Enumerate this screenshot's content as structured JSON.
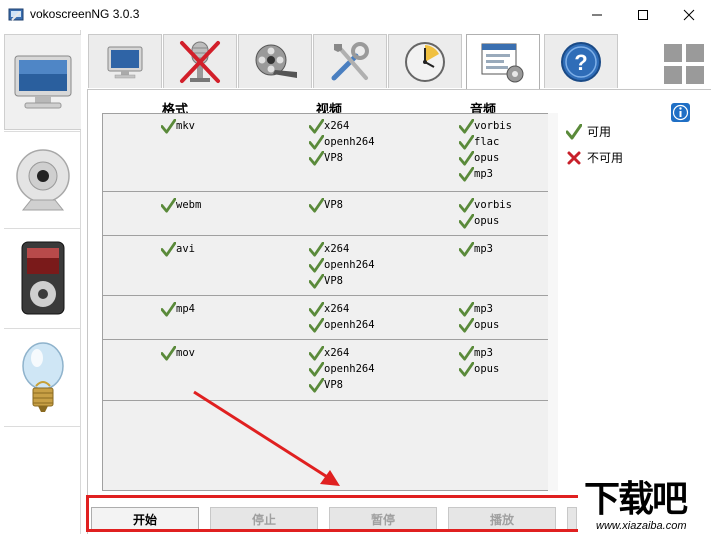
{
  "window": {
    "title": "vokoscreenNG 3.0.3",
    "min_glyph": "—",
    "max_glyph": "☐",
    "close_glyph": "✕"
  },
  "sidebar": {
    "items": [
      {
        "name": "screencast",
        "icon": "monitor-icon",
        "active": true
      },
      {
        "name": "camera",
        "icon": "webcam-icon",
        "active": false
      },
      {
        "name": "player",
        "icon": "media-player-icon",
        "active": false
      },
      {
        "name": "log",
        "icon": "light-bulb-icon",
        "active": false
      }
    ]
  },
  "tabs": [
    {
      "icon": "monitor-icon",
      "active": false
    },
    {
      "icon": "microphone-disabled-icon",
      "active": false
    },
    {
      "icon": "film-reel-icon",
      "active": false
    },
    {
      "icon": "tools-icon",
      "active": false
    },
    {
      "icon": "timer-icon",
      "active": false
    },
    {
      "icon": "window-settings-icon",
      "active": true
    },
    {
      "icon": "help-icon",
      "active": false
    }
  ],
  "table": {
    "headers": {
      "format": "格式",
      "video": "视频",
      "audio": "音频"
    },
    "rows": [
      {
        "format": "mkv",
        "video": [
          "x264",
          "openh264",
          "VP8"
        ],
        "audio": [
          "vorbis",
          "flac",
          "opus",
          "mp3"
        ]
      },
      {
        "format": "webm",
        "video": [
          "VP8"
        ],
        "audio": [
          "vorbis",
          "opus"
        ]
      },
      {
        "format": "avi",
        "video": [
          "x264",
          "openh264",
          "VP8"
        ],
        "audio": [
          "mp3"
        ]
      },
      {
        "format": "mp4",
        "video": [
          "x264",
          "openh264"
        ],
        "audio": [
          "mp3",
          "opus"
        ]
      },
      {
        "format": "mov",
        "video": [
          "x264",
          "openh264",
          "VP8"
        ],
        "audio": [
          "mp3",
          "opus"
        ]
      }
    ]
  },
  "legend": {
    "available": "可用",
    "unavailable": "不可用"
  },
  "buttons": {
    "start": "开始",
    "stop": "停止",
    "pause": "暂停",
    "play": "播放"
  },
  "watermark": {
    "main": "下载吧",
    "sub": "www.xiazaiba.com"
  },
  "colors": {
    "check_green": "#5a8a3a",
    "cross_red": "#c8202a",
    "annotation_red": "#e02020",
    "info_blue": "#1f6fc5"
  }
}
